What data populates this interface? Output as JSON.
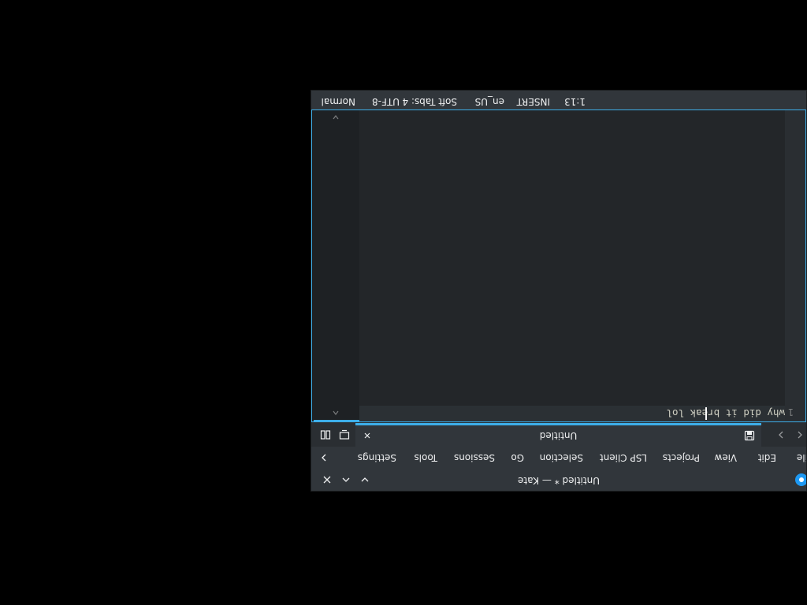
{
  "window": {
    "title": "Untitled * — Kate",
    "app_icon": "kate-app-icon",
    "controls": [
      "minimize-icon",
      "maximize-icon",
      "close-icon"
    ]
  },
  "menubar": {
    "items": [
      "File",
      "Edit",
      "View",
      "Projects",
      "LSP Client",
      "Selection",
      "Go",
      "Sessions",
      "Tools",
      "Settings"
    ],
    "overflow_icon": "chevron-right-icon"
  },
  "tabbar": {
    "nav_icons": [
      "chevron-left-icon",
      "chevron-right-icon"
    ],
    "tab": {
      "title": "Untitled",
      "modified_icon": "save-icon",
      "close_icon": "close-icon"
    },
    "right_icons": [
      "quick-open-icon",
      "split-view-icon"
    ]
  },
  "editor": {
    "line_number": "1",
    "line_text": "why did it break lol",
    "cursor": {
      "line": 1,
      "column": 13
    }
  },
  "statusbar": {
    "position": "1:13",
    "mode": "INSERT",
    "language": "en_US",
    "indentation": "Soft Tabs: 4",
    "encoding": "UTF-8",
    "syntax": "Normal"
  },
  "colors": {
    "accent": "#3daee9",
    "window_bg": "#31363b",
    "editor_bg": "#232629",
    "text": "#eff0f1"
  }
}
